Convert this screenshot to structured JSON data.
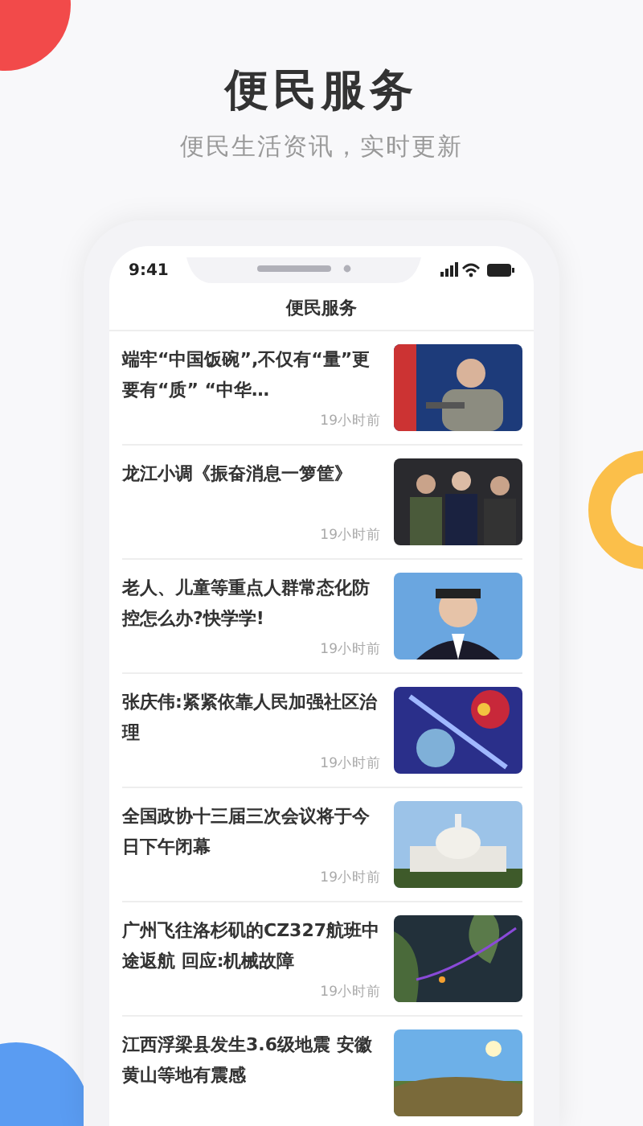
{
  "heading": {
    "title": "便民服务",
    "subtitle": "便民生活资讯，实时更新"
  },
  "phone": {
    "status_time": "9:41",
    "nav_title": "便民服务",
    "news": [
      {
        "title": "端牢“中国饭碗”,不仅有“量”更要有“质” “中华…",
        "time": "19小时前"
      },
      {
        "title": "龙江小调《振奋消息一箩筐》",
        "time": "19小时前"
      },
      {
        "title": "老人、儿童等重点人群常态化防控怎么办?快学学!",
        "time": "19小时前"
      },
      {
        "title": "张庆伟:紧紧依靠人民加强社区治理",
        "time": "19小时前"
      },
      {
        "title": "全国政协十三届三次会议将于今日下午闭幕",
        "time": "19小时前"
      },
      {
        "title": "广州飞往洛杉矶的CZ327航班中途返航 回应:机械故障",
        "time": "19小时前"
      },
      {
        "title": "江西浮梁县发生3.6级地震 安徽黄山等地有震感"
      }
    ]
  }
}
